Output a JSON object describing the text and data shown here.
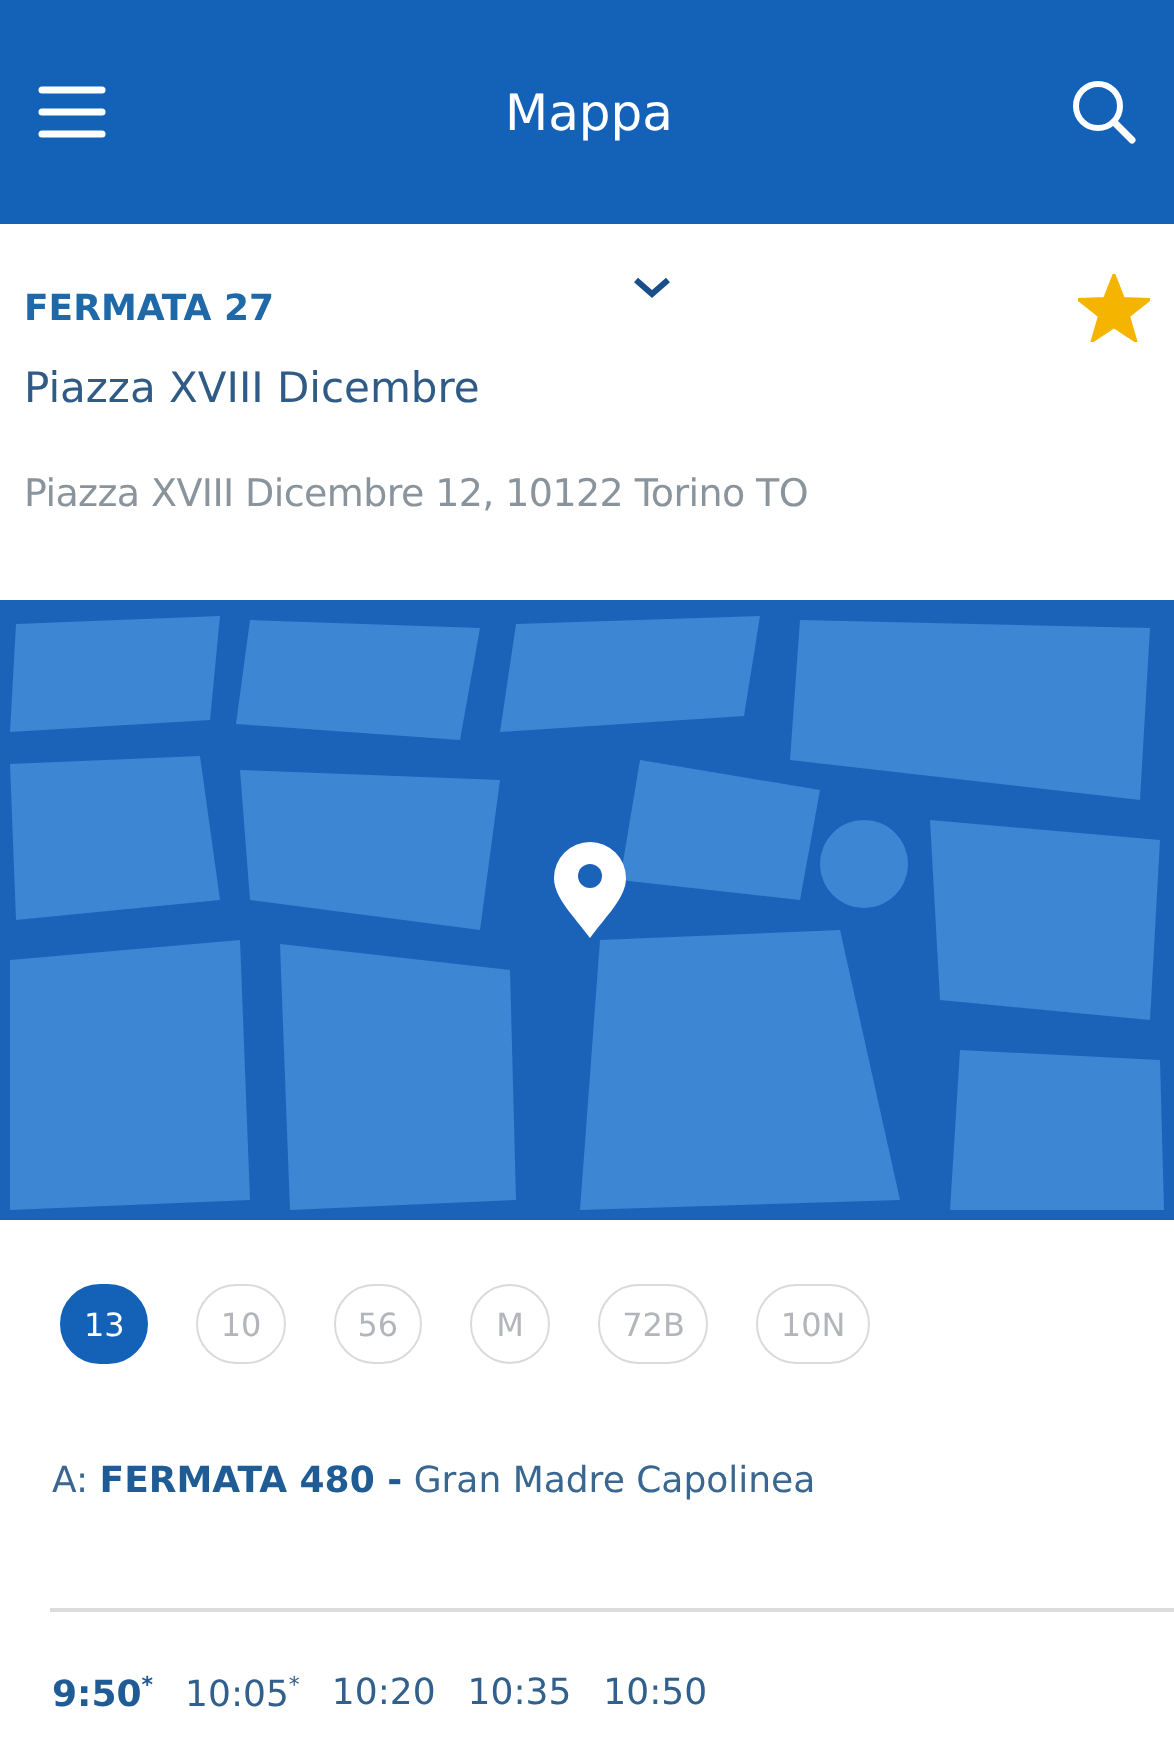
{
  "header": {
    "title": "Mappa"
  },
  "stop": {
    "code": "FERMATA 27",
    "name": "Piazza XVIII Dicembre",
    "address": "Piazza XVIII Dicembre 12, 10122 Torino TO",
    "favorite": true,
    "expanded": false
  },
  "lines": [
    {
      "label": "13",
      "selected": true
    },
    {
      "label": "10",
      "selected": false
    },
    {
      "label": "56",
      "selected": false
    },
    {
      "label": "M",
      "selected": false
    },
    {
      "label": "72B",
      "selected": false
    },
    {
      "label": "10N",
      "selected": false
    }
  ],
  "destination": "A: **FERMATA 480 -** Gran Madre Capolinea",
  "times": [
    {
      "time": "9:50$^{*}$",
      "next": true
    },
    {
      "time": "10:05$^{*}$",
      "next": false
    },
    {
      "time": "10:20",
      "next": false
    },
    {
      "time": "10:35",
      "next": false
    },
    {
      "time": "10:50",
      "next": false
    }
  ]
}
